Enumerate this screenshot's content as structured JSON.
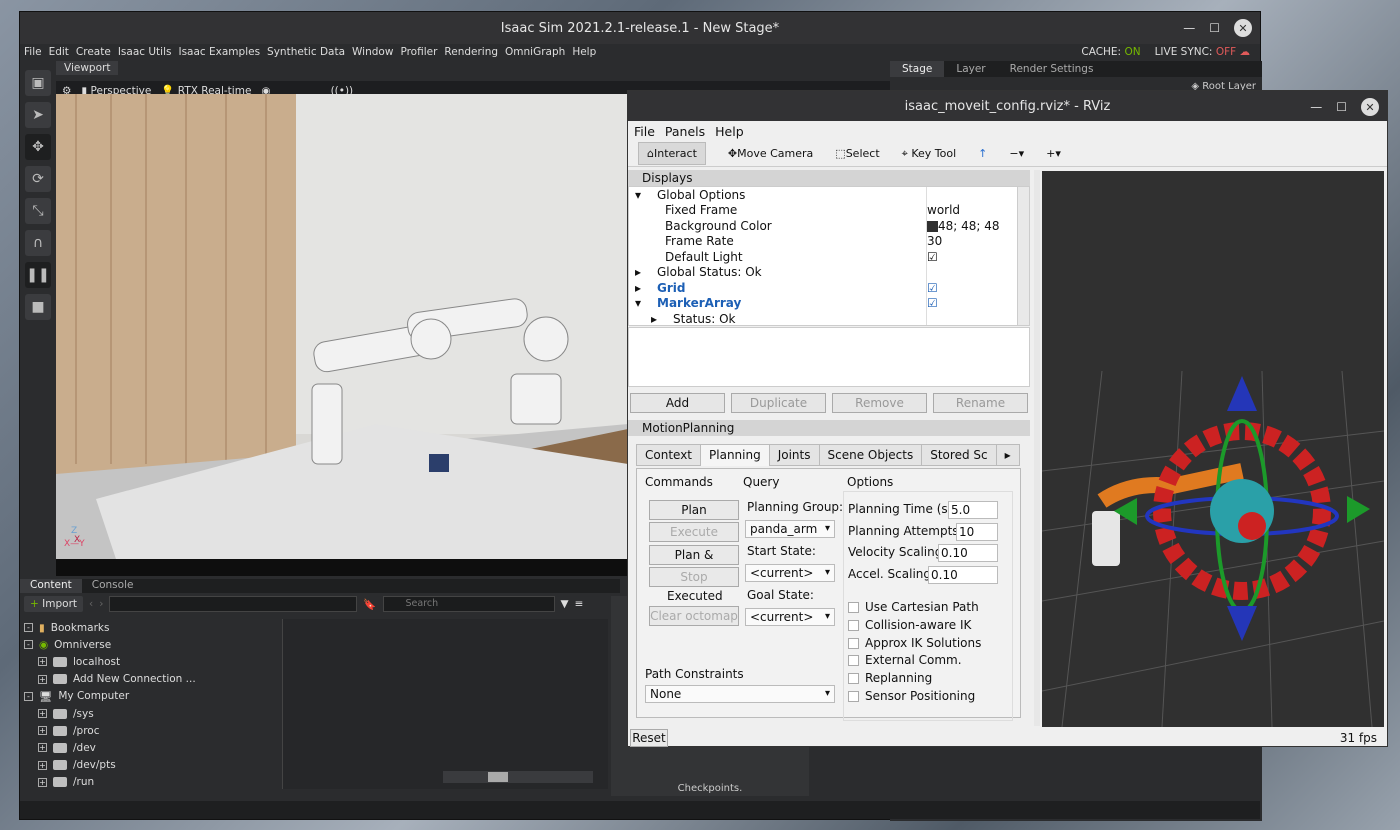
{
  "isaac": {
    "title": "Isaac Sim 2021.2.1-release.1 - New Stage*",
    "menu": [
      "File",
      "Edit",
      "Create",
      "Isaac Utils",
      "Isaac Examples",
      "Synthetic Data",
      "Window",
      "Profiler",
      "Rendering",
      "OmniGraph",
      "Help"
    ],
    "cache_label": "CACHE:",
    "cache_value": "ON",
    "live_label": "LIVE SYNC:",
    "live_value": "OFF",
    "viewport_tab": "Viewport",
    "perspective": "Perspective",
    "rtx": "RTX Real-time",
    "root_layer": "Root Layer",
    "stage_tabs": [
      "Stage",
      "Layer",
      "Render Settings"
    ],
    "content_tabs": [
      "Content",
      "Console"
    ],
    "import": "Import",
    "search_placeholder": "Search",
    "tree": [
      {
        "label": "Bookmarks",
        "exp": "-"
      },
      {
        "label": "Omniverse",
        "exp": "-"
      },
      {
        "label": "localhost",
        "exp": "+"
      },
      {
        "label": "Add New Connection ...",
        "exp": "+"
      },
      {
        "label": "My Computer",
        "exp": "-"
      },
      {
        "label": "/sys",
        "exp": "+"
      },
      {
        "label": "/proc",
        "exp": "+"
      },
      {
        "label": "/dev",
        "exp": "+"
      },
      {
        "label": "/dev/pts",
        "exp": "+"
      },
      {
        "label": "/run",
        "exp": "+"
      }
    ],
    "checkpoints": "Checkpoints.",
    "axis_z": "Z",
    "axis_xy": "X—Y"
  },
  "rviz": {
    "title": "isaac_moveit_config.rviz* - RViz",
    "menu": [
      "File",
      "Panels",
      "Help"
    ],
    "tools": [
      "Interact",
      "Move Camera",
      "Select",
      "Key Tool"
    ],
    "displays_title": "Displays",
    "displays": {
      "global_options": "Global Options",
      "fixed_frame": "Fixed Frame",
      "fixed_frame_val": "world",
      "bg_color": "Background Color",
      "bg_color_val": "48; 48; 48",
      "frame_rate": "Frame Rate",
      "frame_rate_val": "30",
      "default_light": "Default Light",
      "global_status": "Global Status: Ok",
      "grid": "Grid",
      "marker_array": "MarkerArray",
      "status_ok": "Status: Ok"
    },
    "buttons": [
      "Add",
      "Duplicate",
      "Remove",
      "Rename"
    ],
    "mp_title": "MotionPlanning",
    "mp_tabs": [
      "Context",
      "Planning",
      "Joints",
      "Scene Objects",
      "Stored Sc"
    ],
    "commands": "Commands",
    "query": "Query",
    "options": "Options",
    "plan": "Plan",
    "execute": "Execute",
    "plan_execute": "Plan & Execute",
    "stop": "Stop",
    "executed": "Executed",
    "clear_octomap": "Clear octomap",
    "planning_group": "Planning Group:",
    "planning_group_val": "panda_arm",
    "start_state": "Start State:",
    "start_state_val": "<current>",
    "goal_state": "Goal State:",
    "goal_state_val": "<current>",
    "planning_time": "Planning Time (s):",
    "planning_time_val": "5.0",
    "planning_attempts": "Planning Attempts:",
    "planning_attempts_val": "10",
    "velocity_scaling": "Velocity Scaling:",
    "velocity_scaling_val": "0.10",
    "accel_scaling": "Accel. Scaling:",
    "accel_scaling_val": "0.10",
    "checks": [
      "Use Cartesian Path",
      "Collision-aware IK",
      "Approx IK Solutions",
      "External Comm.",
      "Replanning",
      "Sensor Positioning"
    ],
    "path_constraints": "Path Constraints",
    "path_constraints_val": "None",
    "reset": "Reset",
    "fps": "31 fps"
  }
}
